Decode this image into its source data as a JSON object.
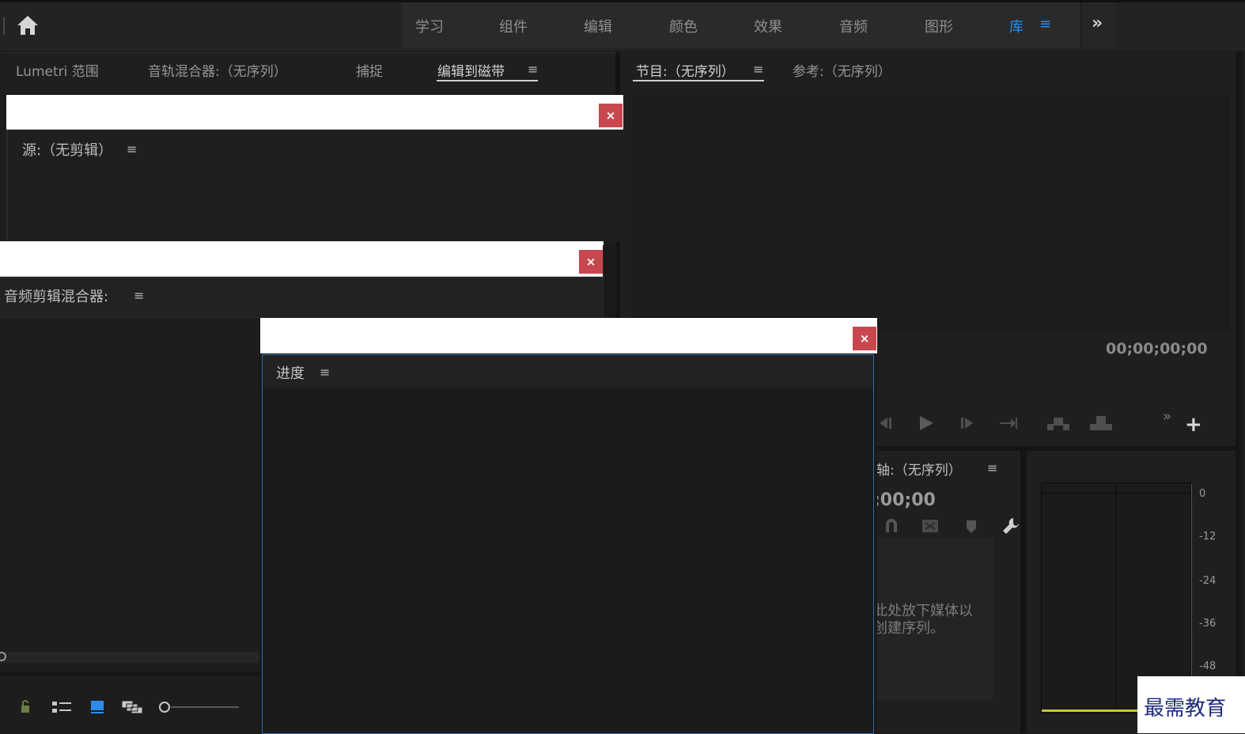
{
  "workspaces": {
    "items": [
      "学习",
      "组件",
      "编辑",
      "颜色",
      "效果",
      "音频",
      "图形",
      "库"
    ],
    "menu_icon": "≡",
    "overflow": "»"
  },
  "upper_left": {
    "tabs": [
      "Lumetri 范围",
      "音轨混合器:（无序列）",
      "捕捉",
      "编辑到磁带"
    ],
    "active_tab": "编辑到磁带"
  },
  "program": {
    "tabs": [
      "节目:（无序列）",
      "参考:（无序列）"
    ],
    "timecode": "00;00;00;00",
    "add_button": "+"
  },
  "source_window": {
    "title": "源:（无剪辑）",
    "close": "×"
  },
  "audio_clip_mixer_window": {
    "title": "音频剪辑混合器:",
    "close": "×"
  },
  "progress_window": {
    "title": "进度",
    "close": "×"
  },
  "timeline": {
    "title": "轴:（无序列）",
    "timecode": ";00;00",
    "drop_hint_1": "此处放下媒体以",
    "drop_hint_2": "创建序列。"
  },
  "audio_meter": {
    "scale": [
      "0",
      "-12",
      "-24",
      "-36",
      "-48"
    ]
  },
  "watermark": {
    "text": "最需教育"
  },
  "colors": {
    "accent": "#2d8ceb",
    "close_button": "#c8474f",
    "meter_baseline": "#c9c43a"
  }
}
